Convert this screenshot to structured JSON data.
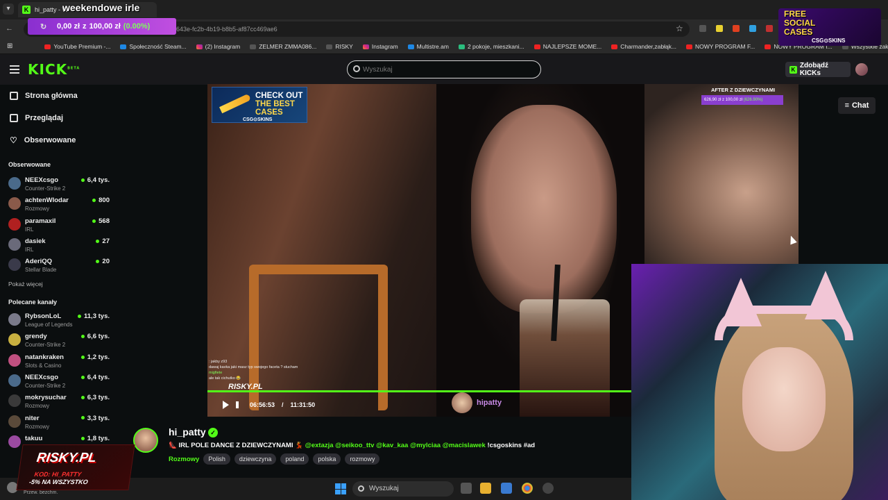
{
  "browser": {
    "tab_title": "hi_patty - W",
    "overlay_title": "weekendowe irle",
    "url": "643e-fc2b-4b19-b8b5-af87cc469ae6",
    "donation": {
      "current": "0,00 zł",
      "sep": "z",
      "goal": "100,00 zł",
      "pct": "(0.00%)"
    },
    "bookmarks": [
      {
        "label": "YouTube Premium -...",
        "icon": "youtube-icon"
      },
      {
        "label": "Społeczność Steam...",
        "icon": "steam-icon"
      },
      {
        "label": "(2) Instagram",
        "icon": "instagram-icon"
      },
      {
        "label": "ZELMER ZMMA086...",
        "icon": "shop-icon"
      },
      {
        "label": "RISKY",
        "icon": "risky-icon"
      },
      {
        "label": "Instagram",
        "icon": "instagram-icon"
      },
      {
        "label": "Multistre.am",
        "icon": "multistream-icon"
      },
      {
        "label": "2 pokoje, mieszkani...",
        "icon": "olx-icon"
      },
      {
        "label": "NAJLEPSZE MOME...",
        "icon": "youtube-icon"
      },
      {
        "label": "Charmander,zabłąk...",
        "icon": "youtube-icon"
      },
      {
        "label": "NOWY PROGRAM F...",
        "icon": "youtube-icon"
      },
      {
        "label": "NOWY PROGRAM I...",
        "icon": "youtube-icon"
      },
      {
        "label": "Wszystkie zakładki",
        "icon": "folder-icon"
      }
    ],
    "csg_banner": {
      "line1": "FREE",
      "line2": "SOCIAL",
      "line3": "CASES",
      "brand": "CSG⊙SKINS"
    }
  },
  "header": {
    "logo": "KICK",
    "logo_sup": "BETA",
    "search_placeholder": "Wyszukaj",
    "get_kicks": "Zdobądź KICKs"
  },
  "sidebar": {
    "nav": [
      {
        "label": "Strona główna",
        "icon": "home-icon"
      },
      {
        "label": "Przeglądaj",
        "icon": "browse-icon"
      },
      {
        "label": "Obserwowane",
        "icon": "heart-icon"
      }
    ],
    "followed_header": "Obserwowane",
    "followed": [
      {
        "name": "NEEXcsgo",
        "category": "Counter-Strike 2",
        "viewers": "6,4 tys.",
        "color": "#4a6a8a"
      },
      {
        "name": "achtenWlodar",
        "category": "Rozmowy",
        "viewers": "800",
        "color": "#8a5a4a"
      },
      {
        "name": "paramaxil",
        "category": "IRL",
        "viewers": "568",
        "color": "#b02020"
      },
      {
        "name": "dasiek",
        "category": "IRL",
        "viewers": "27",
        "color": "#6a6a7a"
      },
      {
        "name": "AderiQQ",
        "category": "Stellar Blade",
        "viewers": "20",
        "color": "#3a3a4a"
      }
    ],
    "show_more": "Pokaż więcej",
    "recommended_header": "Polecane kanały",
    "recommended": [
      {
        "name": "RybsonLoL",
        "category": "League of Legends",
        "viewers": "11,3 tys.",
        "color": "#7a7a8a"
      },
      {
        "name": "grendy",
        "category": "Counter-Strike 2",
        "viewers": "6,6 tys.",
        "color": "#c8b040"
      },
      {
        "name": "natankraken",
        "category": "Slots & Casino",
        "viewers": "1,2 tys.",
        "color": "#c05080"
      },
      {
        "name": "NEEXcsgo",
        "category": "Counter-Strike 2",
        "viewers": "6,4 tys.",
        "color": "#4a6a8a"
      },
      {
        "name": "mokrysuchar",
        "category": "Rozmowy",
        "viewers": "6,3 tys.",
        "color": "#3a3a3a"
      },
      {
        "name": "niter",
        "category": "Rozmowy",
        "viewers": "3,3 tys.",
        "color": "#5a4a3a"
      },
      {
        "name": "takuu",
        "category": "",
        "viewers": "1,8 tys.",
        "color": "#9a4aa0"
      }
    ]
  },
  "video": {
    "ad": {
      "l1": "CHECK OUT",
      "l2": "THE BEST",
      "l3": "CASES",
      "brand": "CSG⊙SKINS"
    },
    "after_title": "AFTER Z DZIEWCZYNAMI",
    "after_bar": "626,90 zł z 100,00 zł",
    "after_pct": "(626.90%)",
    "chat_lines": [
      {
        "user": "",
        "msg": ": jakby z93"
      },
      {
        "user": "",
        "msg": "dawaj kavka jaki masz typ swojego faceta ? słucham"
      },
      {
        "user": "migfiete",
        "msg": ""
      },
      {
        "user": "",
        "msg": "ale tak cichutko 😂"
      }
    ],
    "risky_text": "RISKY.PL",
    "time_current": "06:56:53",
    "time_sep": "/",
    "time_total": "11:31:50",
    "progress_fraction": 0.718,
    "watermark": "hipatty",
    "chat_button": "Chat"
  },
  "streamer": {
    "name": "hi_patty",
    "title_prefix": "👠 IRL POLE DANCE Z DZIEWCZYNAMI 💃 ",
    "title_mentions": "@extazja @seikoo_ttv @kav_kaa @mylciaa @macislawek",
    "title_suffix": " !csgoskins #ad",
    "category": "Rozmowy",
    "tags": [
      "Polish",
      "dziewczyna",
      "poland",
      "polska",
      "rozmowy"
    ]
  },
  "risky_overlay": {
    "logo": "RISKY.PL",
    "code": "KOD: HI_PATTY",
    "promo": "-5% NA WSZYSTKO"
  },
  "taskbar": {
    "search_placeholder": "Wyszukaj",
    "user_label": "Przew. bezchm."
  },
  "colors": {
    "accent": "#53fc18",
    "bg": "#0b0e0f",
    "panel": "#18181b"
  }
}
